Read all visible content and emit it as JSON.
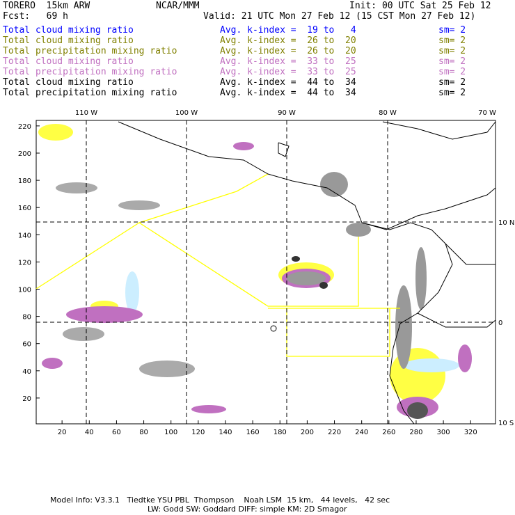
{
  "header": {
    "model": "TORERO  15km ARW",
    "org": "NCAR/MMM",
    "init": "Init: 00 UTC Sat 25 Feb 12",
    "fcst": "Fcst:   69 h",
    "valid": "Valid: 21 UTC Mon 27 Feb 12 (15 CST Mon 27 Feb 12)"
  },
  "legend": [
    {
      "field": "Total cloud mixing ratio",
      "kindex": "Avg. k-index =  19 to   4",
      "sm": "sm= 2",
      "color": "#0000ff"
    },
    {
      "field": "Total cloud mixing ratio",
      "kindex": "Avg. k-index =  26 to  20",
      "sm": "sm= 2",
      "color": "#808000"
    },
    {
      "field": "Total precipitation mixing ratio",
      "kindex": "Avg. k-index =  26 to  20",
      "sm": "sm= 2",
      "color": "#808000"
    },
    {
      "field": "Total cloud mixing ratio",
      "kindex": "Avg. k-index =  33 to  25",
      "sm": "sm= 2",
      "color": "#c070c0"
    },
    {
      "field": "Total precipitation mixing ratio",
      "kindex": "Avg. k-index =  33 to  25",
      "sm": "sm= 2",
      "color": "#c070c0"
    },
    {
      "field": "Total cloud mixing ratio",
      "kindex": "Avg. k-index =  44 to  34",
      "sm": "sm= 2",
      "color": "#000000"
    },
    {
      "field": "Total precipitation mixing ratio",
      "kindex": "Avg. k-index =  44 to  34",
      "sm": "sm= 2",
      "color": "#000000"
    }
  ],
  "map": {
    "x_ticks": [
      "20",
      "40",
      "60",
      "80",
      "100",
      "120",
      "140",
      "160",
      "180",
      "200",
      "220",
      "240",
      "260",
      "280",
      "300",
      "320"
    ],
    "y_ticks": [
      "20",
      "40",
      "60",
      "80",
      "100",
      "120",
      "140",
      "160",
      "180",
      "200",
      "220"
    ],
    "lon_labels": [
      "110 W",
      "100 W",
      "90 W",
      "80 W",
      "70 W"
    ],
    "lat_labels": [
      "10 N",
      "0",
      "10 S"
    ]
  },
  "footer": {
    "line1": "Model Info: V3.3.1   Tiedtke YSU PBL  Thompson    Noah LSM  15 km,   44 levels,   42 sec",
    "line2": "LW: Godd SW: Goddard DIFF: simple KM: 2D Smagor"
  }
}
